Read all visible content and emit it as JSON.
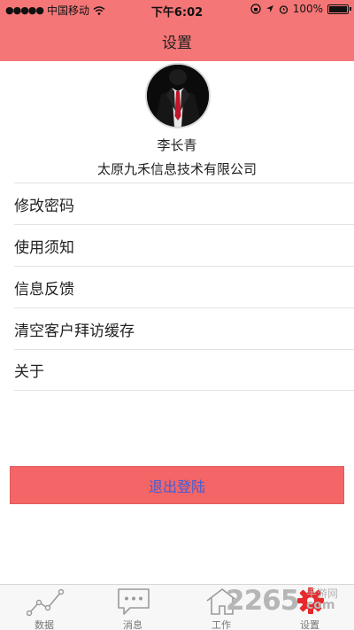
{
  "status_bar": {
    "carrier": "中国移动",
    "time": "下午6:02",
    "battery": "100%"
  },
  "header": {
    "title": "设置"
  },
  "profile": {
    "name": "李长青",
    "company": "太原九禾信息技术有限公司"
  },
  "menu": {
    "items": [
      {
        "label": "修改密码"
      },
      {
        "label": "使用须知"
      },
      {
        "label": "信息反馈"
      },
      {
        "label": "清空客户拜访缓存"
      },
      {
        "label": "关于"
      }
    ]
  },
  "logout": {
    "label": "退出登陆"
  },
  "tabbar": {
    "tabs": [
      {
        "label": "数据",
        "icon": "chart-line-icon"
      },
      {
        "label": "消息",
        "icon": "chat-bubble-icon"
      },
      {
        "label": "工作",
        "icon": "home-icon"
      },
      {
        "label": "设置",
        "icon": "gear-icon"
      }
    ],
    "active_index": 3
  },
  "watermark": {
    "number": "2265",
    "domain": "com",
    "site": "手游网"
  },
  "colors": {
    "header_bg": "#f47677",
    "logout_bg": "#f36566",
    "logout_text": "#3f5fd9",
    "tab_active_icon": "#e8282b"
  }
}
